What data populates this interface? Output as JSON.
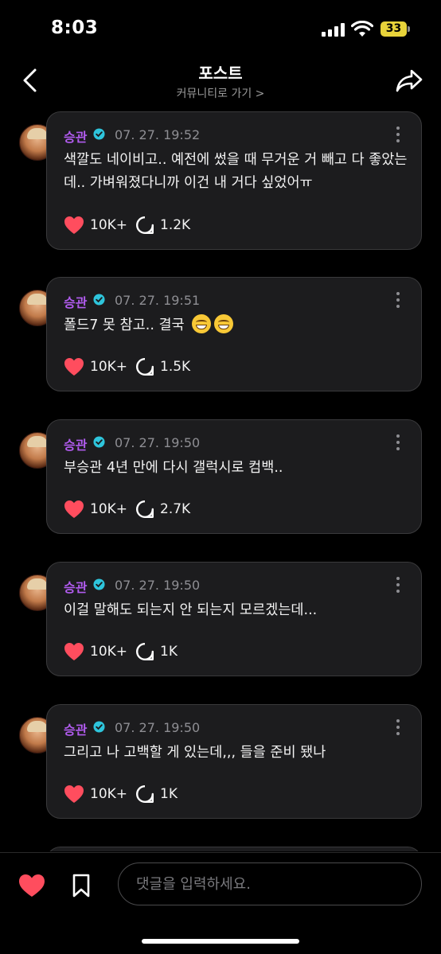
{
  "status_bar": {
    "time": "8:03",
    "battery": "33",
    "battery_color": "#e8d33a"
  },
  "header": {
    "title": "포스트",
    "subtitle": "커뮤니티로 가기 >"
  },
  "colors": {
    "author": "#b25cf0",
    "verified": "#2ec5dc",
    "like": "#ff4d5e"
  },
  "posts": [
    {
      "author": "승관",
      "time": "07. 27. 19:52",
      "text": "색깔도 네이비고.. 예전에 썼을 때 무거운 거 빼고 다 좋았는데.. 가벼워졌다니까 이건 내 거다 싶었어ㅠ",
      "likes": "10K+",
      "comments": "1.2K"
    },
    {
      "author": "승관",
      "time": "07. 27. 19:51",
      "text": "폴드7 못 참고.. 결국",
      "emoji": [
        "grinning-face",
        "grinning-face"
      ],
      "likes": "10K+",
      "comments": "1.5K"
    },
    {
      "author": "승관",
      "time": "07. 27. 19:50",
      "text": "부승관 4년 만에 다시 갤럭시로 컴백..",
      "likes": "10K+",
      "comments": "2.7K"
    },
    {
      "author": "승관",
      "time": "07. 27. 19:50",
      "text": "이걸 말해도 되는지 안 되는지 모르겠는데...",
      "likes": "10K+",
      "comments": "1K"
    },
    {
      "author": "승관",
      "time": "07. 27. 19:50",
      "text": "그리고 나 고백할 게 있는데,,, 들을 준비 됐나",
      "likes": "10K+",
      "comments": "1K"
    }
  ],
  "bottom_bar": {
    "comment_placeholder": "댓글을 입력하세요."
  }
}
